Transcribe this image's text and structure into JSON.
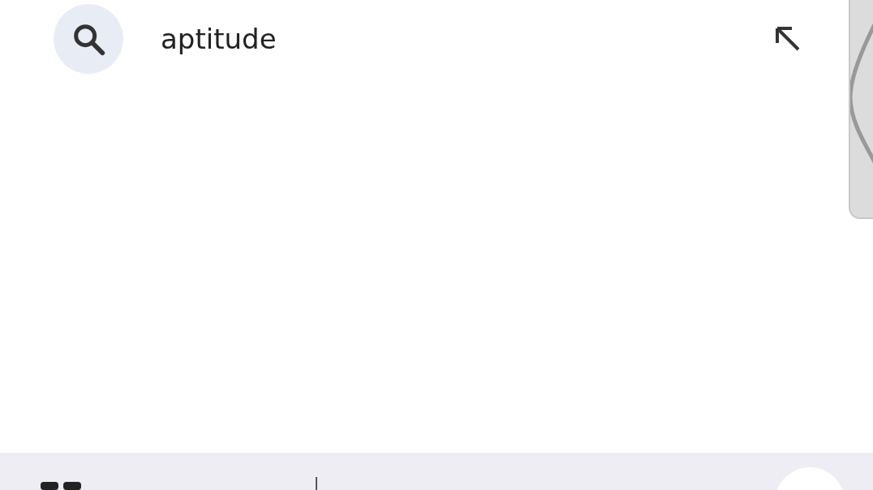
{
  "suggestions": [
    {
      "text": "aptitude"
    }
  ]
}
